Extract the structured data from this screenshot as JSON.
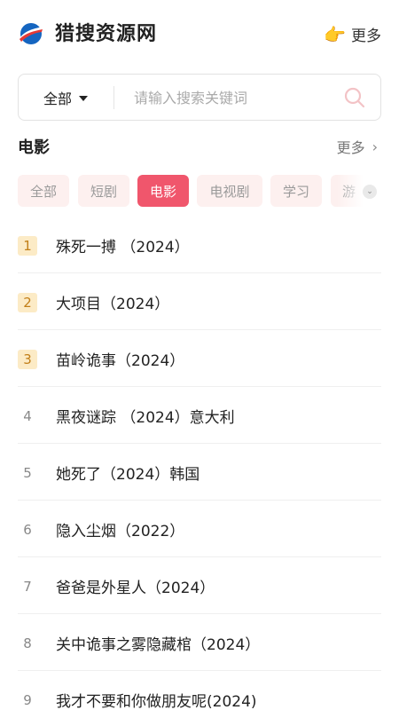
{
  "header": {
    "title": "猎搜资源网",
    "more_label": "更多",
    "logo_icon": "logo-icon",
    "more_icon": "pointing-hand-icon"
  },
  "search": {
    "scope_label": "全部",
    "placeholder": "请输入搜索关键词",
    "value": ""
  },
  "section": {
    "title": "电影",
    "more_label": "更多",
    "more_chevron": "›"
  },
  "tabs": [
    {
      "label": "全部",
      "active": false
    },
    {
      "label": "短剧",
      "active": false
    },
    {
      "label": "电影",
      "active": true
    },
    {
      "label": "电视剧",
      "active": false
    },
    {
      "label": "学习",
      "active": false
    },
    {
      "label": "游",
      "active": false
    }
  ],
  "list": [
    {
      "rank": "1",
      "title": "殊死一搏 （2024）"
    },
    {
      "rank": "2",
      "title": "大项目（2024）"
    },
    {
      "rank": "3",
      "title": "苗岭诡事（2024）"
    },
    {
      "rank": "4",
      "title": "黑夜谜踪 （2024）意大利"
    },
    {
      "rank": "5",
      "title": "她死了（2024）韩国"
    },
    {
      "rank": "6",
      "title": "隐入尘烟（2022）"
    },
    {
      "rank": "7",
      "title": "爸爸是外星人（2024）"
    },
    {
      "rank": "8",
      "title": "关中诡事之雾隐藏棺（2024）"
    },
    {
      "rank": "9",
      "title": "我才不要和你做朋友呢(2024)"
    }
  ],
  "colors": {
    "accent": "#f0566c",
    "tab_bg": "#fdf0ef",
    "rank_top_bg": "#fcebc6",
    "rank_top_text": "#c27f18"
  }
}
